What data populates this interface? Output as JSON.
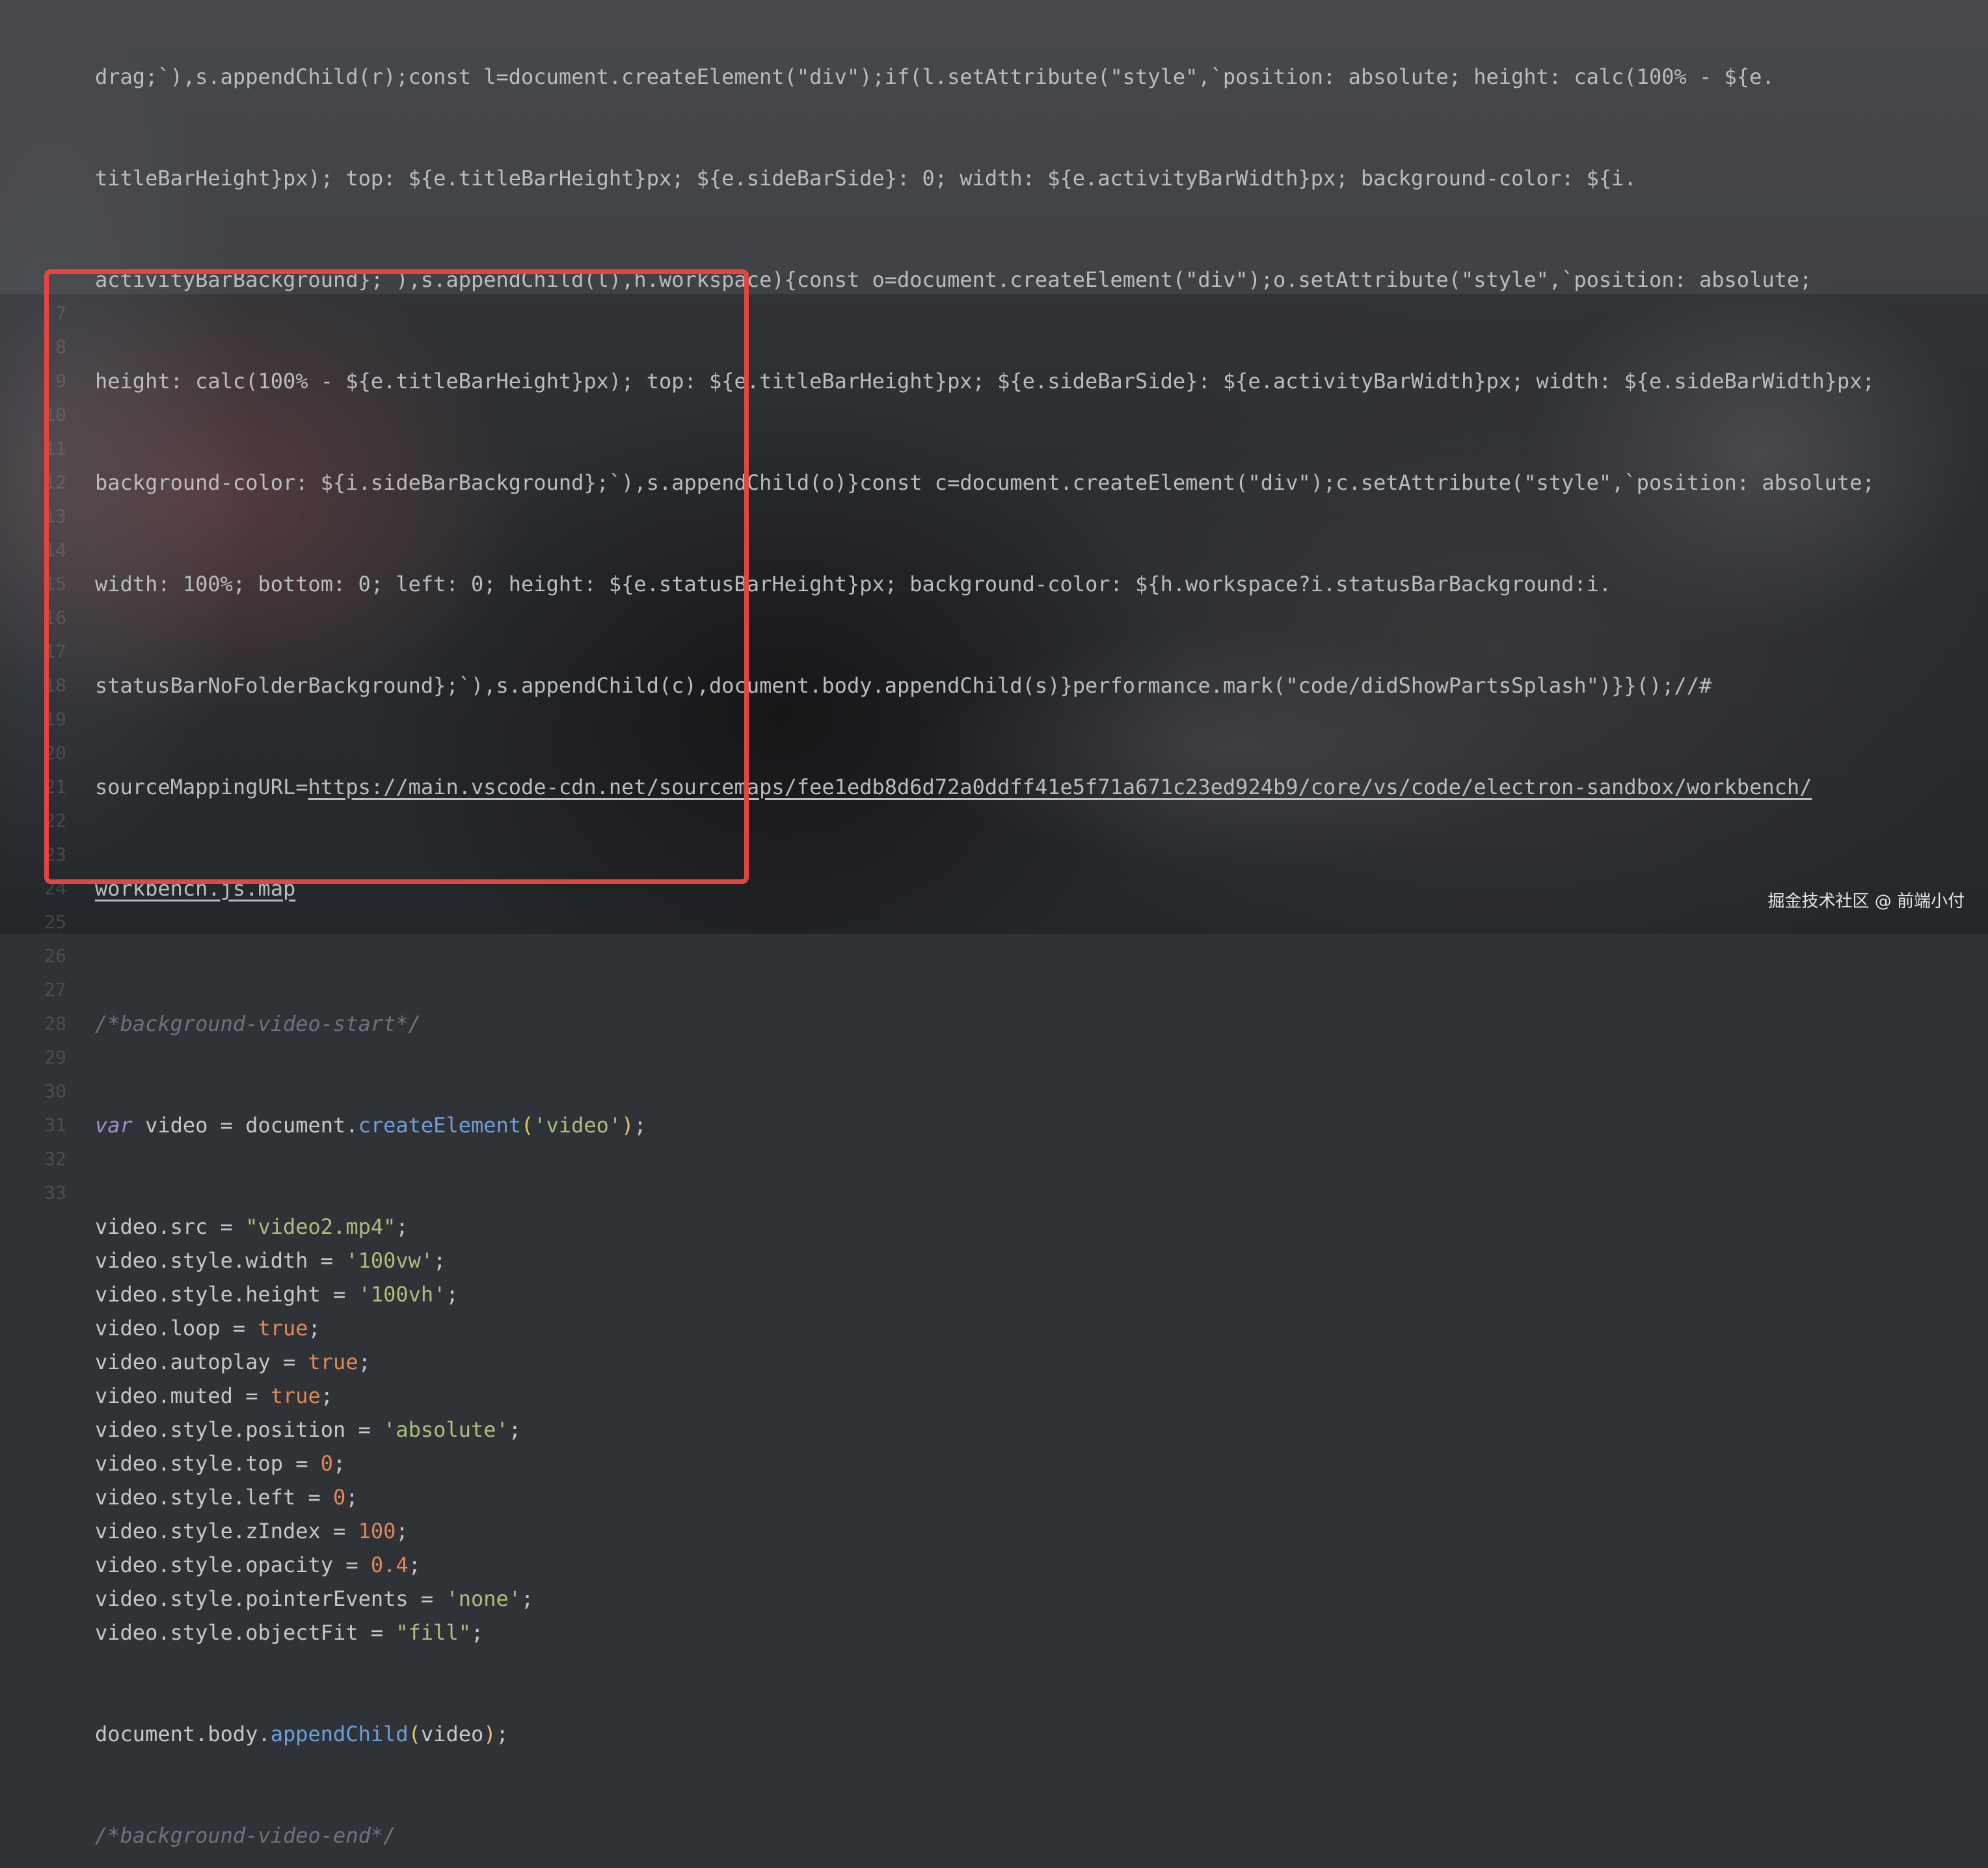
{
  "background": {
    "description_icon": "background-video-icon"
  },
  "minified_lines": [
    "drag;`),s.appendChild(r);const l=document.createElement(\"div\");if(l.setAttribute(\"style\",`position: absolute; height: calc(100% - ${e.",
    "titleBarHeight}px); top: ${e.titleBarHeight}px; ${e.sideBarSide}: 0; width: ${e.activityBarWidth}px; background-color: ${i.",
    "activityBarBackground};`),s.appendChild(l),h.workspace){const o=document.createElement(\"div\");o.setAttribute(\"style\",`position: absolute;",
    "height: calc(100% - ${e.titleBarHeight}px); top: ${e.titleBarHeight}px; ${e.sideBarSide}: ${e.activityBarWidth}px; width: ${e.sideBarWidth}px;",
    "background-color: ${i.sideBarBackground};`),s.appendChild(o)}const c=document.createElement(\"div\");c.setAttribute(\"style\",`position: absolute;",
    "width: 100%; bottom: 0; left: 0; height: ${e.statusBarHeight}px; background-color: ${h.workspace?i.statusBarBackground:i.",
    "statusBarNoFolderBackground};`),s.appendChild(c),document.body.appendChild(s)}performance.mark(\"code/didShowPartsSplash\")}}();//#"
  ],
  "sourcemap": {
    "prefix": "sourceMappingURL=",
    "url_line1": "https://main.vscode-cdn.net/sourcemaps/fee1edb8d6d72a0ddff41e5f71a671c23ed924b9/core/vs/code/electron-sandbox/workbench/",
    "url_line2": "workbench.js.map"
  },
  "snippet": {
    "start_comment": "/*background-video-start*/",
    "end_comment": "/*background-video-end*/",
    "line_var": {
      "kw": "var",
      "name": " video = document.",
      "fn": "createElement",
      "open": "(",
      "arg": "'video'",
      "close": ")",
      "end": ";"
    },
    "lines": [
      {
        "lhs": "video.src = ",
        "value": "\"video2.mp4\"",
        "type": "str"
      },
      {
        "lhs": "video.style.width = ",
        "value": "'100vw'",
        "type": "str"
      },
      {
        "lhs": "video.style.height = ",
        "value": "'100vh'",
        "type": "str"
      },
      {
        "lhs": "video.loop = ",
        "value": "true",
        "type": "num"
      },
      {
        "lhs": "video.autoplay = ",
        "value": "true",
        "type": "num"
      },
      {
        "lhs": "video.muted = ",
        "value": "true",
        "type": "num"
      },
      {
        "lhs": "video.style.position = ",
        "value": "'absolute'",
        "type": "str"
      },
      {
        "lhs": "video.style.top = ",
        "value": "0",
        "type": "num"
      },
      {
        "lhs": "video.style.left = ",
        "value": "0",
        "type": "num"
      },
      {
        "lhs": "video.style.zIndex = ",
        "value": "100",
        "type": "num"
      },
      {
        "lhs": "video.style.opacity = ",
        "value": "0.4",
        "type": "num"
      },
      {
        "lhs": "video.style.pointerEvents = ",
        "value": "'none'",
        "type": "str"
      },
      {
        "lhs": "video.style.objectFit = ",
        "value": "\"fill\"",
        "type": "str"
      }
    ],
    "append_line": {
      "lhs": "document.body.",
      "fn": "appendChild",
      "open": "(",
      "arg": "video",
      "close": ")",
      "end": ";"
    }
  },
  "gutter_numbers": [
    "7",
    "8",
    "9",
    "10",
    "11",
    "12",
    "13",
    "14",
    "15",
    "16",
    "17",
    "18",
    "19",
    "20",
    "21",
    "22",
    "23",
    "24",
    "25",
    "26",
    "27",
    "28",
    "29",
    "30",
    "31",
    "32",
    "33"
  ],
  "watermark": "掘金技术社区 @ 前端小付",
  "colors": {
    "highlight_border": "#e3463f",
    "keyword": "#a88ad6",
    "string": "#a8c07a",
    "number": "#e08856",
    "function": "#6d9fd8",
    "comment": "#6d737c"
  }
}
